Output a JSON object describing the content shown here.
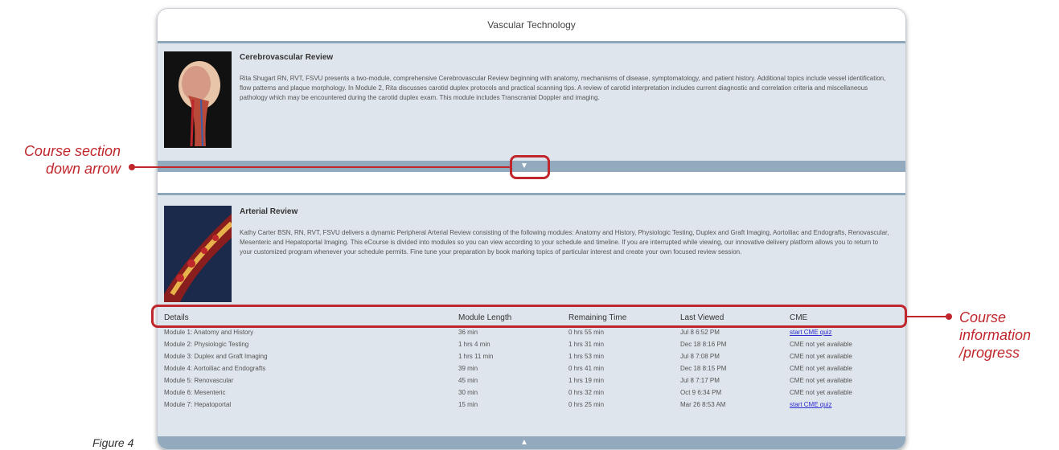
{
  "panel": {
    "title": "Vascular Technology"
  },
  "courses": [
    {
      "title": "Cerebrovascular Review",
      "description": "Rita Shugart RN, RVT, FSVU presents a two-module, comprehensive Cerebrovascular Review beginning with anatomy, mechanisms of disease, symptomatology, and patient history. Additional topics include vessel identification, flow patterns and plaque morphology. In Module 2, Rita discusses carotid duplex protocols and practical scanning tips. A review of carotid interpretation includes current diagnostic and correlation criteria and miscellaneous pathology which may be encountered during the carotid duplex exam. This module includes Transcranial Doppler and imaging."
    },
    {
      "title": "Arterial Review",
      "description": "Kathy Carter BSN, RN, RVT, FSVU delivers a dynamic Peripheral Arterial Review consisting of the following modules: Anatomy and History, Physiologic Testing, Duplex and Graft Imaging, Aortoiliac and Endografts, Renovascular, Mesenteric and Hepatoportal Imaging. This eCourse is divided into modules so you can view according to your schedule and timeline. If you are interrupted while viewing, our innovative delivery platform allows you to return to your customized program whenever your schedule permits. Fine tune your preparation by book marking topics of particular interest and create your own focused review session."
    }
  ],
  "details": {
    "headers": {
      "details": "Details",
      "length": "Module Length",
      "remaining": "Remaining Time",
      "last": "Last Viewed",
      "cme": "CME"
    },
    "rows": [
      {
        "name": "Module 1: Anatomy and History",
        "length": "36 min",
        "remaining": "0 hrs 55 min",
        "last": "Jul 8 6:52 PM",
        "cme": "start CME quiz",
        "cme_link": true
      },
      {
        "name": "Module 2: Physiologic Testing",
        "length": "1 hrs 4 min",
        "remaining": "1 hrs 31 min",
        "last": "Dec 18 8:16 PM",
        "cme": "CME not yet available",
        "cme_link": false
      },
      {
        "name": "Module 3: Duplex and Graft Imaging",
        "length": "1 hrs 11 min",
        "remaining": "1 hrs 53 min",
        "last": "Jul 8 7:08 PM",
        "cme": "CME not yet available",
        "cme_link": false
      },
      {
        "name": "Module 4: Aortoiliac and Endografts",
        "length": "39 min",
        "remaining": "0 hrs 41 min",
        "last": "Dec 18 8:15 PM",
        "cme": "CME not yet available",
        "cme_link": false
      },
      {
        "name": "Module 5: Renovascular",
        "length": "45 min",
        "remaining": "1 hrs 19 min",
        "last": "Jul 8 7:17 PM",
        "cme": "CME not yet available",
        "cme_link": false
      },
      {
        "name": "Module 6: Mesenteric",
        "length": "30 min",
        "remaining": "0 hrs 32 min",
        "last": "Oct 9 6:34 PM",
        "cme": "CME not yet available",
        "cme_link": false
      },
      {
        "name": "Module 7: Hepatoportal",
        "length": "15 min",
        "remaining": "0 hrs 25 min",
        "last": "Mar 26 8:53 AM",
        "cme": "start CME quiz",
        "cme_link": true
      }
    ]
  },
  "annotations": {
    "left_line1": "Course section",
    "left_line2": "down arrow",
    "right_line1": "Course",
    "right_line2": "information",
    "right_line3": "/progress"
  },
  "caption": "Figure 4",
  "colors": {
    "accent": "#c0272d",
    "bar": "#93a9bd",
    "link": "#2b2ed0"
  },
  "icons": {
    "down": "triangle-down-icon",
    "up": "triangle-up-icon"
  }
}
